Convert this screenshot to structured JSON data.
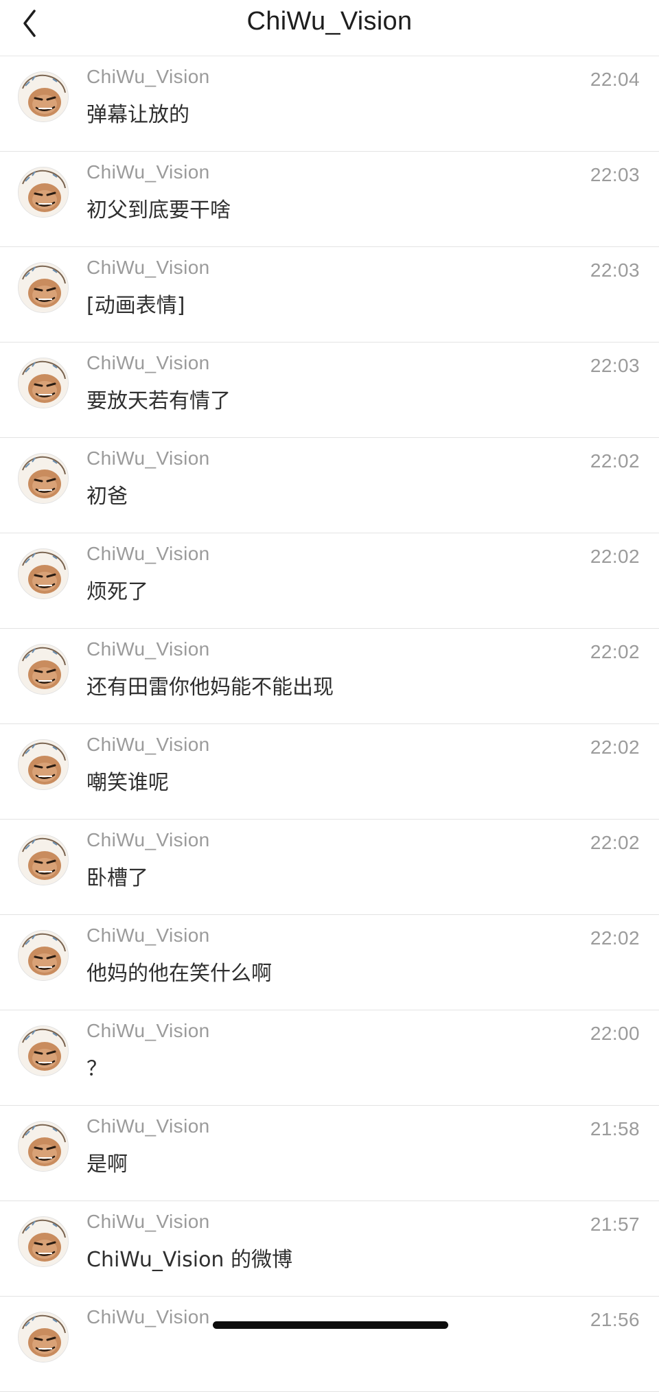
{
  "header": {
    "title": "ChiWu_Vision",
    "back_icon": "chevron-left-icon"
  },
  "messages": [
    {
      "sender": "ChiWu_Vision",
      "text": "弹幕让放的",
      "time": "22:04"
    },
    {
      "sender": "ChiWu_Vision",
      "text": "初父到底要干啥",
      "time": "22:03"
    },
    {
      "sender": "ChiWu_Vision",
      "text": "[动画表情]",
      "time": "22:03"
    },
    {
      "sender": "ChiWu_Vision",
      "text": "要放天若有情了",
      "time": "22:03"
    },
    {
      "sender": "ChiWu_Vision",
      "text": "初爸",
      "time": "22:02"
    },
    {
      "sender": "ChiWu_Vision",
      "text": "烦死了",
      "time": "22:02"
    },
    {
      "sender": "ChiWu_Vision",
      "text": "还有田雷你他妈能不能出现",
      "time": "22:02"
    },
    {
      "sender": "ChiWu_Vision",
      "text": "嘲笑谁呢",
      "time": "22:02"
    },
    {
      "sender": "ChiWu_Vision",
      "text": "卧槽了",
      "time": "22:02"
    },
    {
      "sender": "ChiWu_Vision",
      "text": "他妈的他在笑什么啊",
      "time": "22:02"
    },
    {
      "sender": "ChiWu_Vision",
      "text": "？",
      "time": "22:00"
    },
    {
      "sender": "ChiWu_Vision",
      "text": "是啊",
      "time": "21:58"
    },
    {
      "sender": "ChiWu_Vision",
      "text": "ChiWu_Vision 的微博",
      "time": "21:57"
    },
    {
      "sender": "ChiWu_Vision",
      "text": "",
      "time": "21:56"
    }
  ],
  "colors": {
    "meta_text": "#9b9b9b",
    "message_text": "#2f2f2f",
    "divider": "#e3e3e3"
  }
}
